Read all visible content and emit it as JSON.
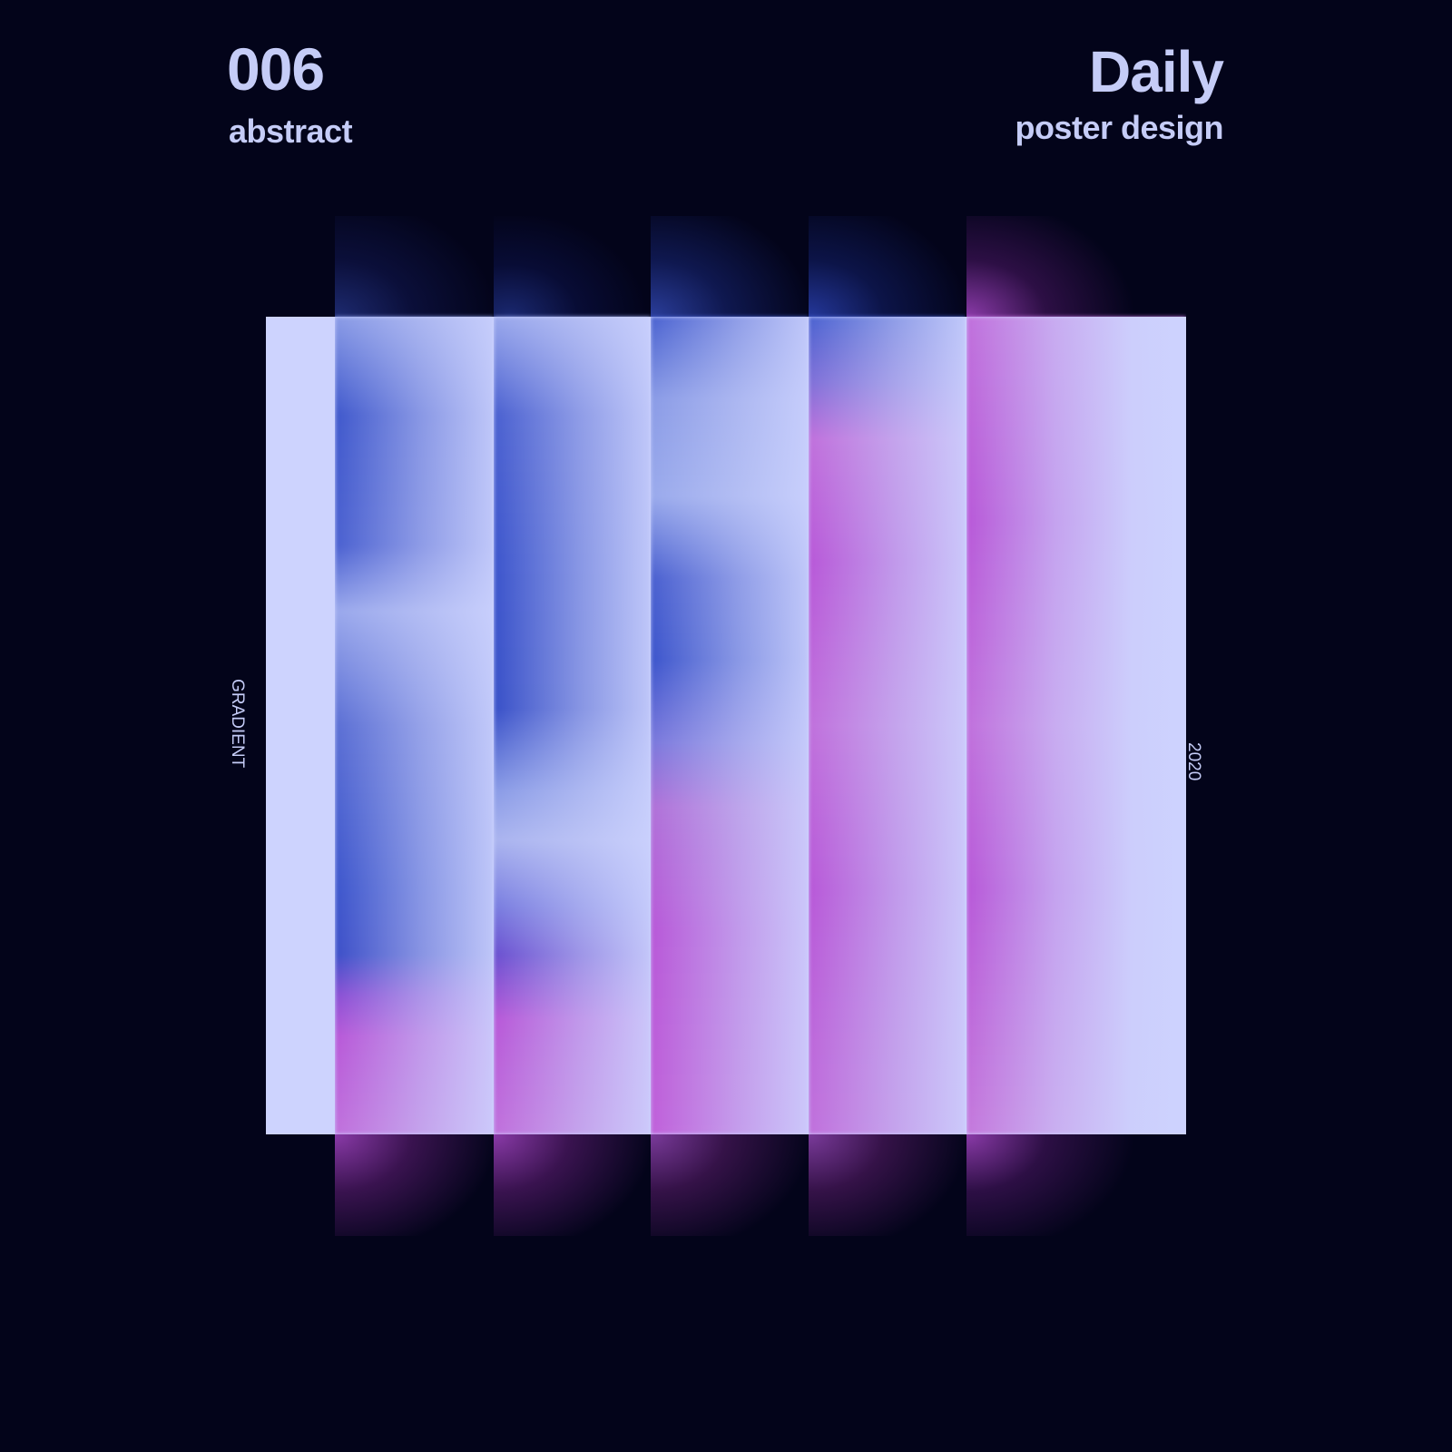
{
  "header": {
    "number": "006",
    "category": "abstract",
    "title": "Daily",
    "subtitle": "poster design"
  },
  "side_labels": {
    "left": "GRADIENT",
    "right": "2020"
  },
  "colors": {
    "background": "#03041a",
    "text": "#c5ccf7",
    "panel": "#cdd3fe",
    "blue": "#3c55cc",
    "magenta": "#b858d8"
  }
}
